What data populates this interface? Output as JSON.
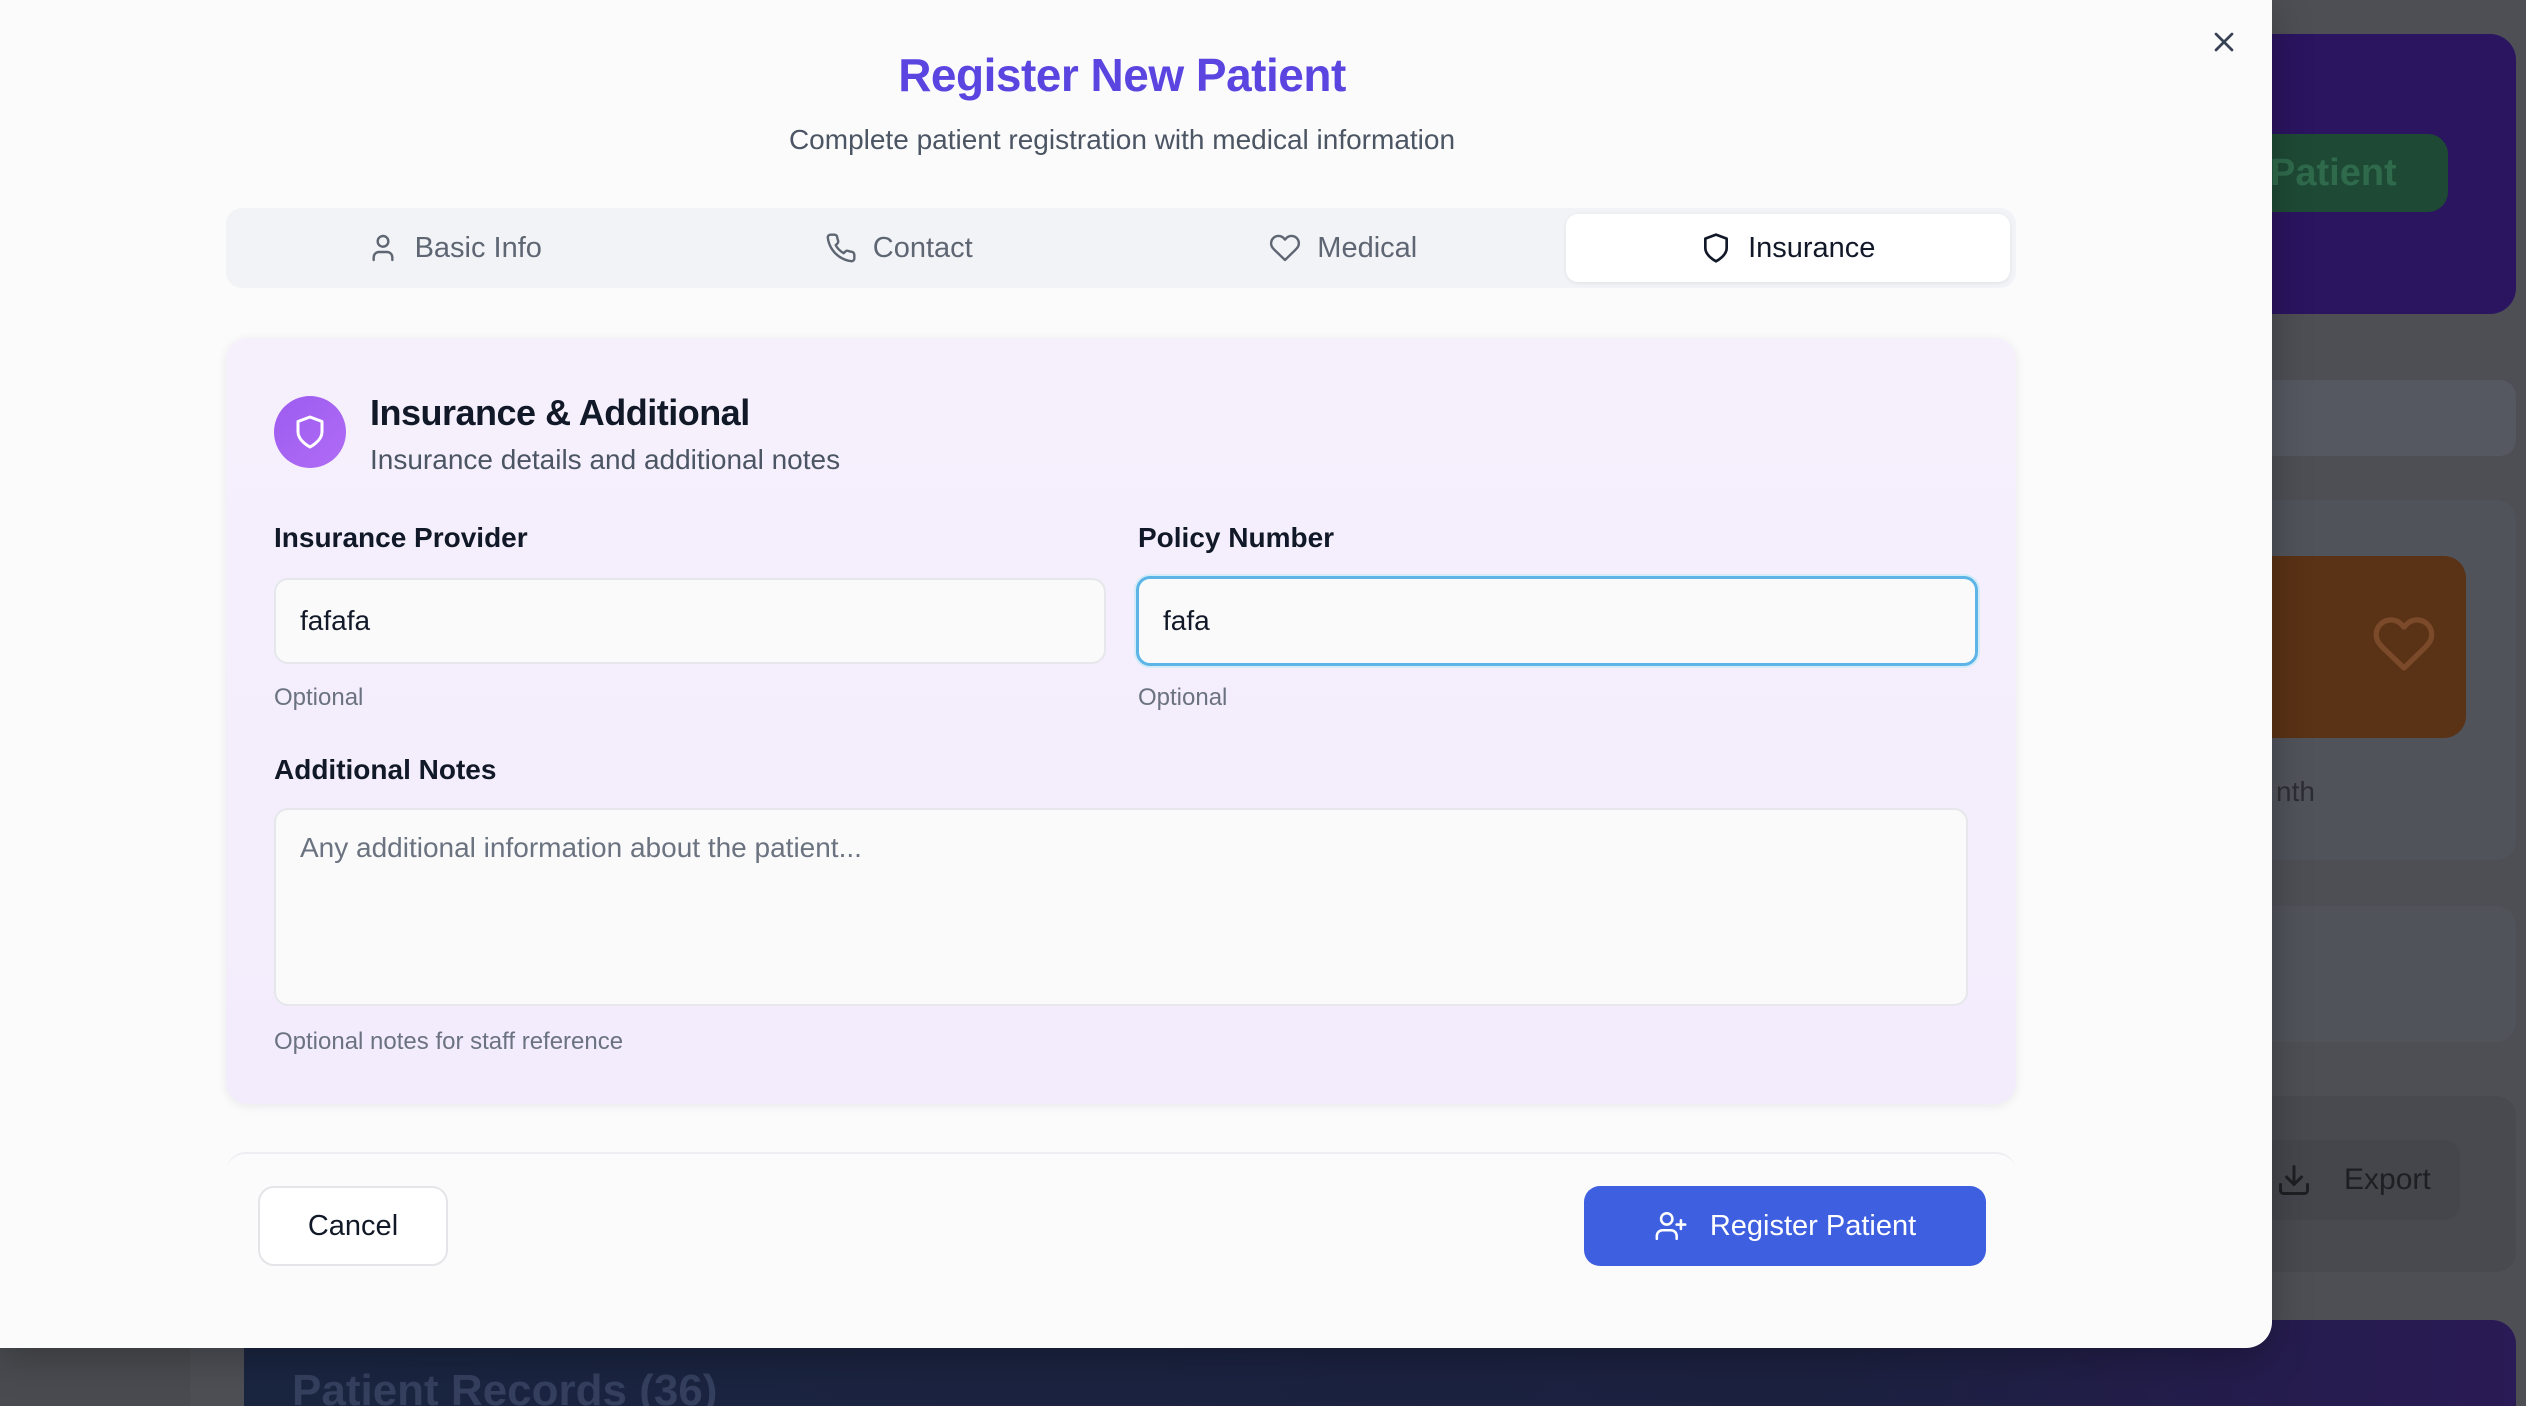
{
  "background": {
    "hero_button_text": "Patient",
    "stat_suffix": "nth",
    "export_label": "Export",
    "records_title": "Patient Records (36)"
  },
  "dialog": {
    "title": "Register New Patient",
    "subtitle": "Complete patient registration with medical information",
    "close_icon": "close-icon"
  },
  "tabs": [
    {
      "label": "Basic Info",
      "icon": "user-icon",
      "active": false
    },
    {
      "label": "Contact",
      "icon": "phone-icon",
      "active": false
    },
    {
      "label": "Medical",
      "icon": "heart-icon",
      "active": false
    },
    {
      "label": "Insurance",
      "icon": "shield-icon",
      "active": true
    }
  ],
  "section": {
    "title": "Insurance & Additional",
    "subtitle": "Insurance details and additional notes",
    "icon": "shield-icon",
    "accent": "#a561f2"
  },
  "fields": {
    "insurance_provider": {
      "label": "Insurance Provider",
      "value": "fafafa",
      "hint": "Optional"
    },
    "policy_number": {
      "label": "Policy Number",
      "value": "fafa",
      "hint": "Optional"
    },
    "additional_notes": {
      "label": "Additional Notes",
      "placeholder": "Any additional information about the patient...",
      "value": "",
      "hint": "Optional notes for staff reference"
    }
  },
  "footer": {
    "cancel_label": "Cancel",
    "register_label": "Register Patient",
    "register_color": "#3e5fe0"
  }
}
